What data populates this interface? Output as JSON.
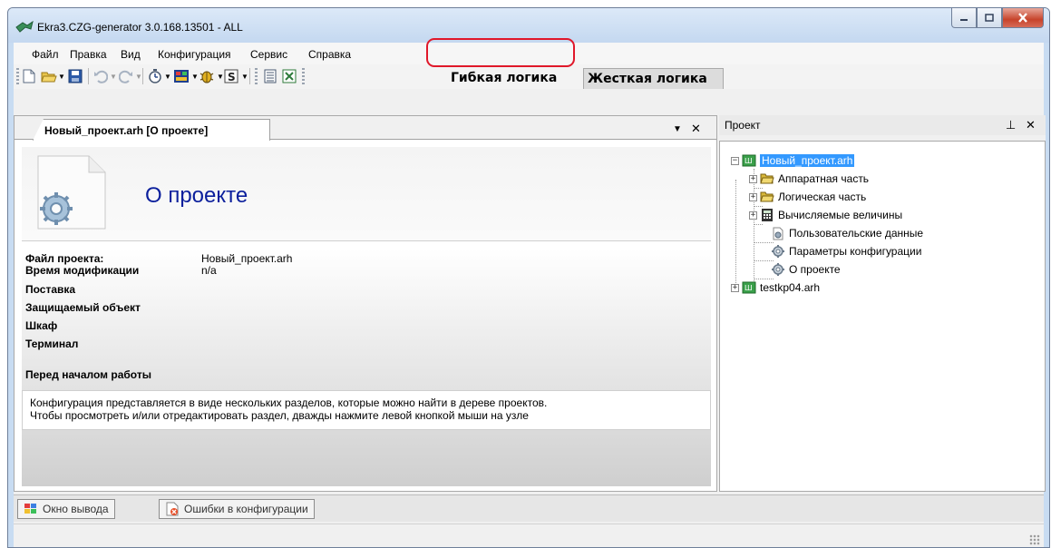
{
  "window": {
    "title": "Ekra3.CZG-generator 3.0.168.13501 - ALL"
  },
  "menu": {
    "items": [
      "Файл",
      "Правка",
      "Вид",
      "Конфигурация",
      "Сервис",
      "Справка"
    ]
  },
  "toolbar": {
    "tab_flexible_logic": "Гибкая логика",
    "tab_hard_logic": "Жесткая логика",
    "highlight_color": "#e0182a"
  },
  "document": {
    "tab_label": "Новый_проект.arh [О проекте]",
    "heading": "О проекте",
    "properties": [
      {
        "label": "Файл проекта:",
        "value": "Новый_проект.arh"
      },
      {
        "label": "Время модификации",
        "value": "n/a"
      }
    ],
    "sections": [
      "Поставка",
      "Защищаемый объект",
      "Шкаф",
      "Терминал"
    ],
    "before_start_heading": "Перед началом работы",
    "info_lines": [
      "Конфигурация представляется в виде нескольких разделов, которые можно найти в дереве проектов.",
      "Чтобы просмотреть и/или отредактировать раздел, дважды нажмите левой кнопкой мыши на узле"
    ]
  },
  "project_panel": {
    "title": "Проект",
    "tree": {
      "root": "Новый_проект.arh",
      "children": [
        "Аппаратная часть",
        "Логическая часть",
        "Вычисляемые величины",
        "Пользовательские данные",
        "Параметры конфигурации",
        "О проекте"
      ],
      "second_root": "testkp04.arh"
    },
    "selection_color": "#3399ff"
  },
  "bottom": {
    "tabs": [
      "Окно вывода",
      "Ошибки в конфигурации"
    ]
  },
  "icons": [
    "app-icon",
    "minimize-icon",
    "maximize-icon",
    "close-icon",
    "new-icon",
    "open-icon",
    "save-icon",
    "undo-icon",
    "redo-icon",
    "timer-icon",
    "chip-icon",
    "bug-icon",
    "dollar-icon",
    "list-icon",
    "excel-icon",
    "pin-icon",
    "project-icon",
    "folder-icon",
    "calculator-icon",
    "gear-icon"
  ]
}
